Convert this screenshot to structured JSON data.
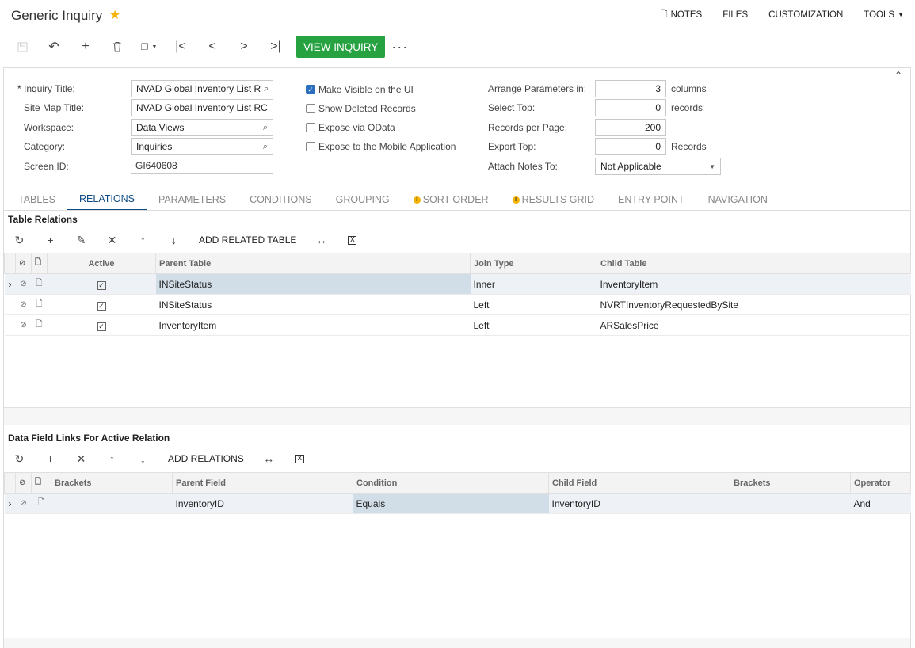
{
  "header": {
    "title": "Generic Inquiry",
    "links": [
      "NOTES",
      "FILES",
      "CUSTOMIZATION",
      "TOOLS"
    ]
  },
  "toolbar": {
    "primary_label": "VIEW INQUIRY"
  },
  "form": {
    "inquiry_title_label": "Inquiry Title:",
    "inquiry_title_value": "NVAD Global Inventory List R",
    "site_map_title_label": "Site Map Title:",
    "site_map_title_value": "NVAD Global Inventory List RC",
    "workspace_label": "Workspace:",
    "workspace_value": "Data Views",
    "category_label": "Category:",
    "category_value": "Inquiries",
    "screen_id_label": "Screen ID:",
    "screen_id_value": "GI640608",
    "make_visible_label": "Make Visible on the UI",
    "show_deleted_label": "Show Deleted Records",
    "expose_odata_label": "Expose via OData",
    "expose_mobile_label": "Expose to the Mobile Application",
    "arrange_label": "Arrange Parameters in:",
    "arrange_value": "3",
    "arrange_unit": "columns",
    "select_top_label": "Select Top:",
    "select_top_value": "0",
    "select_top_unit": "records",
    "records_per_page_label": "Records per Page:",
    "records_per_page_value": "200",
    "export_top_label": "Export Top:",
    "export_top_value": "0",
    "export_top_unit": "Records",
    "attach_notes_label": "Attach Notes To:",
    "attach_notes_value": "Not Applicable"
  },
  "tabs": [
    "TABLES",
    "RELATIONS",
    "PARAMETERS",
    "CONDITIONS",
    "GROUPING",
    "SORT ORDER",
    "RESULTS GRID",
    "ENTRY POINT",
    "NAVIGATION"
  ],
  "relations": {
    "title": "Table Relations",
    "add_label": "ADD RELATED TABLE",
    "headers": {
      "active": "Active",
      "parent": "Parent Table",
      "join": "Join Type",
      "child": "Child Table"
    },
    "rows": [
      {
        "parent": "INSiteStatus",
        "join": "Inner",
        "child": "InventoryItem"
      },
      {
        "parent": "INSiteStatus",
        "join": "Left",
        "child": "NVRTInventoryRequestedBySite"
      },
      {
        "parent": "InventoryItem",
        "join": "Left",
        "child": "ARSalesPrice"
      }
    ]
  },
  "links": {
    "title": "Data Field Links For Active Relation",
    "add_label": "ADD RELATIONS",
    "headers": {
      "brackets1": "Brackets",
      "parent": "Parent Field",
      "condition": "Condition",
      "child": "Child Field",
      "brackets2": "Brackets",
      "operator": "Operator"
    },
    "rows": [
      {
        "brackets1": "",
        "parent": "InventoryID",
        "condition": "Equals",
        "child": "InventoryID",
        "brackets2": "",
        "operator": "And"
      }
    ]
  }
}
